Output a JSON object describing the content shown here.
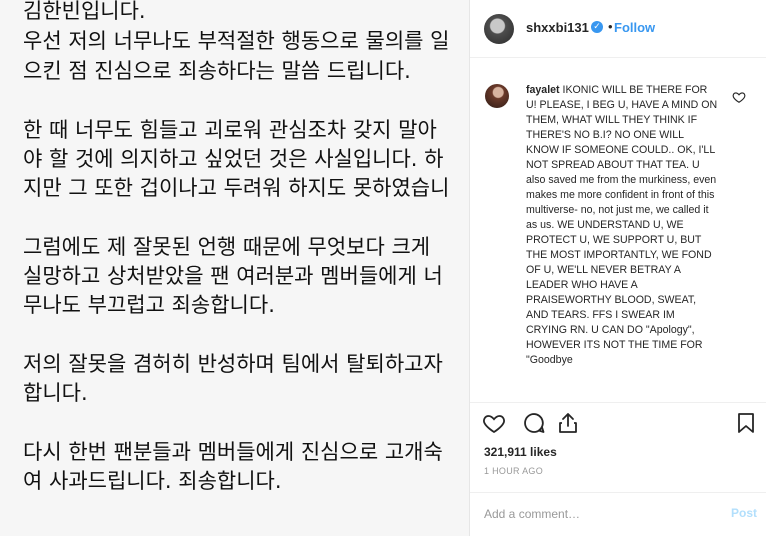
{
  "photo": {
    "lines": [
      "김한빈입니다.",
      "우선 저의 너무나도 부적절한 행동으로 물의를 일",
      "으킨 점 진심으로 죄송하다는 말씀 드립니다.",
      "",
      "한 때 너무도 힘들고 괴로워 관심조차 갖지 말아",
      "야 할 것에 의지하고 싶었던 것은 사실입니다. 하",
      "지만 그 또한 겁이나고 두려워 하지도 못하였습니",
      "",
      "그럼에도 제 잘못된 언행 때문에 무엇보다 크게",
      "실망하고 상처받았을 팬 여러분과 멤버들에게 너",
      "무나도 부끄럽고 죄송합니다.",
      "",
      "저의 잘못을 겸허히 반성하며 팀에서 탈퇴하고자",
      "합니다.",
      "",
      "다시 한번 팬분들과 멤버들에게 진심으로 고개숙",
      "여 사과드립니다. 죄송합니다."
    ]
  },
  "header": {
    "username": "shxxbi131",
    "verified_icon": "verified-badge-icon",
    "separator": "•",
    "follow_label": "Follow"
  },
  "comment": {
    "username": "fayalet",
    "text": "IKONIC WILL BE THERE FOR U! PLEASE, I BEG U, HAVE A MIND ON THEM, WHAT WILL THEY THINK IF THERE'S NO B.I? NO ONE WILL KNOW IF SOMEONE COULD.. OK, I'LL NOT SPREAD ABOUT THAT TEA. U also saved me from the murkiness, even makes me more confident in front of this multiverse- no, not just me, we called it as us. WE UNDERSTAND U, WE PROTECT U, WE SUPPORT U, BUT THE MOST IMPORTANTLY, WE FOND OF U, WE'LL NEVER BETRAY A LEADER WHO HAVE A PRAISEWORTHY BLOOD, SWEAT, AND TEARS. FFS I SWEAR IM CRYING RN. U CAN DO \"Apology\", HOWEVER ITS NOT THE TIME FOR \"Goodbye"
  },
  "actions": {
    "icons": [
      "heart-icon",
      "comment-icon",
      "share-icon",
      "bookmark-icon"
    ]
  },
  "likes": "321,911 likes",
  "timestamp": "1 HOUR AGO",
  "add_comment": {
    "placeholder": "Add a comment…",
    "post_label": "Post"
  },
  "colors": {
    "accent": "#3897f0",
    "post_disabled": "#b2dffc",
    "text": "#262626",
    "muted": "#999999",
    "photo_bg": "#f6f6f6"
  }
}
